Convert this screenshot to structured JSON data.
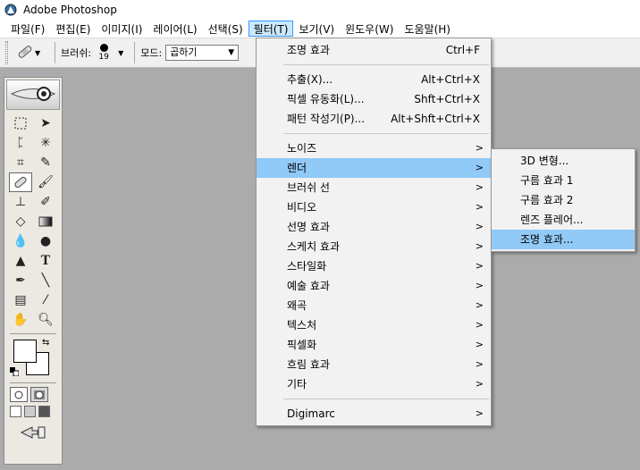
{
  "window": {
    "title": "Adobe Photoshop"
  },
  "menubar": {
    "items": [
      {
        "label": "파일(F)"
      },
      {
        "label": "편집(E)"
      },
      {
        "label": "이미지(I)"
      },
      {
        "label": "레이어(L)"
      },
      {
        "label": "선택(S)"
      },
      {
        "label": "필터(T)"
      },
      {
        "label": "보기(V)"
      },
      {
        "label": "윈도우(W)"
      },
      {
        "label": "도움말(H)"
      }
    ],
    "active_index": 5
  },
  "options": {
    "brush_label": "브러쉬:",
    "brush_size": "19",
    "mode_label": "모드:",
    "mode_value": "곱하기"
  },
  "filter_menu": {
    "last_filter": {
      "label": "조명 효과",
      "shortcut": "Ctrl+F"
    },
    "group1": [
      {
        "label": "추출(X)...",
        "shortcut": "Alt+Ctrl+X"
      },
      {
        "label": "픽셀 유동화(L)...",
        "shortcut": "Shft+Ctrl+X"
      },
      {
        "label": "패턴 작성기(P)...",
        "shortcut": "Alt+Shft+Ctrl+X"
      }
    ],
    "group2": [
      {
        "label": "노이즈"
      },
      {
        "label": "렌더"
      },
      {
        "label": "브러쉬 선"
      },
      {
        "label": "비디오"
      },
      {
        "label": "선명 효과"
      },
      {
        "label": "스케치 효과"
      },
      {
        "label": "스타일화"
      },
      {
        "label": "예술 효과"
      },
      {
        "label": "왜곡"
      },
      {
        "label": "텍스처"
      },
      {
        "label": "픽셀화"
      },
      {
        "label": "흐림 효과"
      },
      {
        "label": "기타"
      }
    ],
    "group3": [
      {
        "label": "Digimarc"
      }
    ],
    "submenu_arrow": ">"
  },
  "render_submenu": {
    "items": [
      {
        "label": "3D 변형..."
      },
      {
        "label": "구름 효과 1"
      },
      {
        "label": "구름 효과 2"
      },
      {
        "label": "렌즈 플레어..."
      },
      {
        "label": "조명 효과..."
      }
    ]
  },
  "colors": {
    "menu_highlight": "#91c9f7",
    "menubar_active": "#cce8ff",
    "workspace": "#ababab"
  }
}
